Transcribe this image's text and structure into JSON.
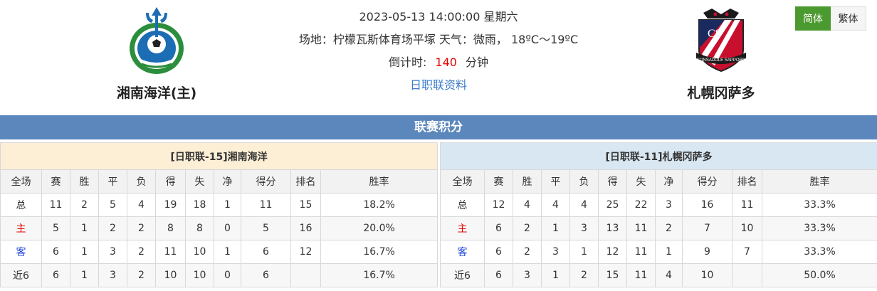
{
  "match": {
    "datetime": "2023-05-13 14:00:00 星期六",
    "venue_line": "场地：柠檬瓦斯体育场平塚 天气：微雨， 18ºC～19ºC",
    "countdown_label": "倒计时:",
    "countdown_value": "140",
    "countdown_unit": "分钟",
    "league_link": "日职联资料"
  },
  "home_team": {
    "name": "湘南海洋(主)",
    "logo_icon": "shonan-bellmare-crest-icon"
  },
  "away_team": {
    "name": "札幌冈萨多",
    "logo_icon": "consadole-sapporo-crest-icon"
  },
  "lang": {
    "simplified": "简体",
    "traditional": "繁体"
  },
  "section_title": "联赛积分",
  "columns": [
    "全场",
    "赛",
    "胜",
    "平",
    "负",
    "得",
    "失",
    "净",
    "得分",
    "排名",
    "胜率"
  ],
  "left_table": {
    "title": "[日职联-15]湘南海洋",
    "rows": [
      [
        "总",
        "11",
        "2",
        "5",
        "4",
        "19",
        "18",
        "1",
        "11",
        "15",
        "18.2%"
      ],
      [
        "主",
        "5",
        "1",
        "2",
        "2",
        "8",
        "8",
        "0",
        "5",
        "16",
        "20.0%"
      ],
      [
        "客",
        "6",
        "1",
        "3",
        "2",
        "11",
        "10",
        "1",
        "6",
        "12",
        "16.7%"
      ],
      [
        "近6",
        "6",
        "1",
        "3",
        "2",
        "10",
        "10",
        "0",
        "6",
        "",
        "16.7%"
      ]
    ]
  },
  "right_table": {
    "title": "[日职联-11]札幌冈萨多",
    "rows": [
      [
        "总",
        "12",
        "4",
        "4",
        "4",
        "25",
        "22",
        "3",
        "16",
        "11",
        "33.3%"
      ],
      [
        "主",
        "6",
        "2",
        "1",
        "3",
        "13",
        "11",
        "2",
        "7",
        "10",
        "33.3%"
      ],
      [
        "客",
        "6",
        "2",
        "3",
        "1",
        "12",
        "11",
        "1",
        "9",
        "7",
        "33.3%"
      ],
      [
        "近6",
        "6",
        "3",
        "1",
        "2",
        "15",
        "11",
        "4",
        "10",
        "",
        "50.0%"
      ]
    ]
  },
  "colors": {
    "section_bar": "#5b87bd",
    "active_lang": "#4b9a2f",
    "home_label": "#e60000",
    "away_label": "#1a3fd6",
    "countdown": "#e60000",
    "link": "#3b7bc8"
  }
}
